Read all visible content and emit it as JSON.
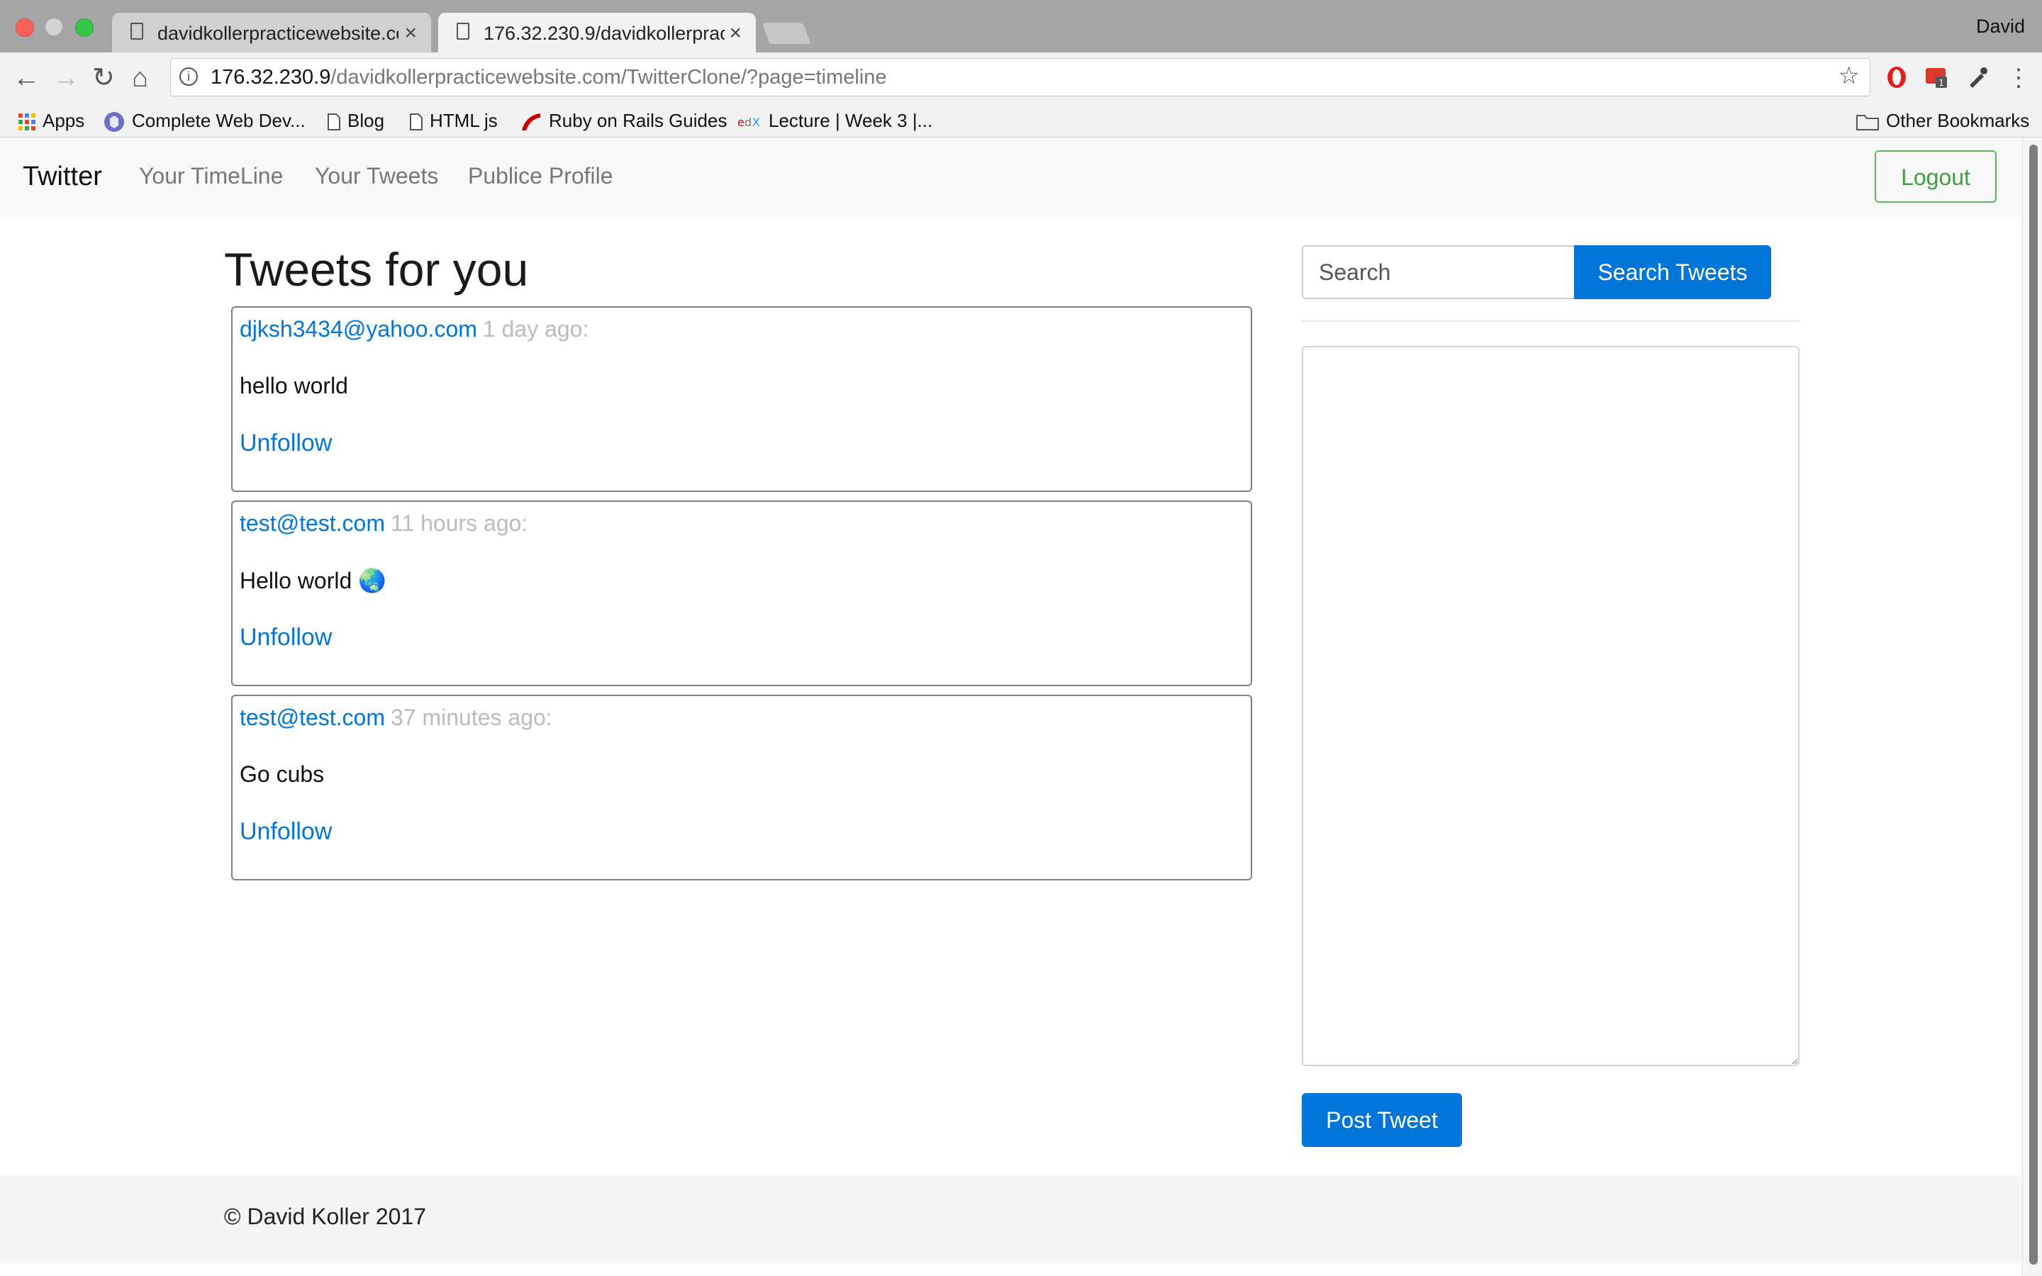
{
  "browser": {
    "tabs": [
      {
        "title": "davidkollerpracticewebsite.com",
        "close": "×"
      },
      {
        "title": "176.32.230.9/davidkollerpractice",
        "close": "×"
      }
    ],
    "profile": "David",
    "nav": {
      "back": "←",
      "forward": "→",
      "reload": "↻",
      "home": "⌂"
    },
    "url_host": "176.32.230.9",
    "url_path": "/davidkollerpracticewebsite.com/TwitterClone/?page=timeline",
    "star": "☆",
    "info": "i",
    "menu": "⋮",
    "bookmarks": [
      {
        "label": "Apps",
        "icon": "apps-grid-icon"
      },
      {
        "label": "Complete Web Dev...",
        "icon": "course-icon"
      },
      {
        "label": "Blog",
        "icon": "page-icon"
      },
      {
        "label": "HTML js",
        "icon": "page-icon"
      },
      {
        "label": "Ruby on Rails Guides",
        "icon": "rails-icon"
      },
      {
        "label": "Lecture | Week 3 |...",
        "icon": "edx-icon"
      }
    ],
    "other_bookmarks": "Other Bookmarks"
  },
  "navbar": {
    "brand": "Twitter",
    "links": [
      "Your TimeLine",
      "Your Tweets",
      "Publice Profile"
    ],
    "logout": "Logout"
  },
  "main": {
    "heading": "Tweets for you",
    "tweets": [
      {
        "author": "djksh3434@yahoo.com",
        "time": "1 day ago:",
        "body": "hello world",
        "action": "Unfollow"
      },
      {
        "author": "test@test.com",
        "time": "11 hours ago:",
        "body": "Hello world 🌏",
        "action": "Unfollow"
      },
      {
        "author": "test@test.com",
        "time": "37 minutes ago:",
        "body": "Go cubs",
        "action": "Unfollow"
      }
    ]
  },
  "sidebar": {
    "search_placeholder": "Search",
    "search_button": "Search Tweets",
    "post_button": "Post Tweet"
  },
  "footer": {
    "copyright": "© David Koller 2017"
  },
  "colors": {
    "primary": "#0275d8",
    "success": "#5cb85c",
    "muted": "#bbbbbb"
  }
}
